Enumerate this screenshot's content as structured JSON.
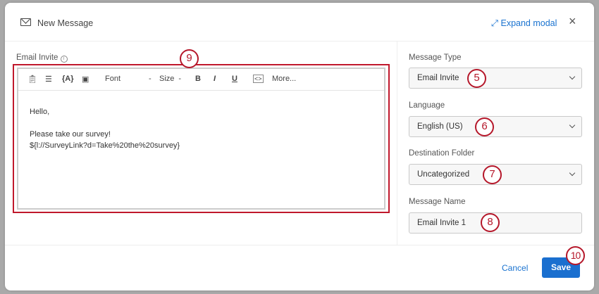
{
  "header": {
    "title": "New Message",
    "expand_label": "Expand modal",
    "close_icon": "×"
  },
  "editor": {
    "label": "Email Invite",
    "toolbar": {
      "font": "Font",
      "size": "Size",
      "bold": "B",
      "italic": "I",
      "underline": "U",
      "more": "More..."
    },
    "lines": [
      "Hello,",
      "",
      "Please take our survey!",
      "${l://SurveyLink?d=Take%20the%20survey}"
    ]
  },
  "fields": {
    "message_type": {
      "label": "Message Type",
      "value": "Email Invite"
    },
    "language": {
      "label": "Language",
      "value": "English (US)"
    },
    "destination_folder": {
      "label": "Destination Folder",
      "value": "Uncategorized"
    },
    "message_name": {
      "label": "Message Name",
      "value": "Email Invite 1"
    }
  },
  "footer": {
    "cancel": "Cancel",
    "save": "Save"
  },
  "callouts": [
    "5",
    "6",
    "7",
    "8",
    "9",
    "10"
  ],
  "colors": {
    "accent": "#1a6fcf",
    "callout": "#b5172a"
  }
}
